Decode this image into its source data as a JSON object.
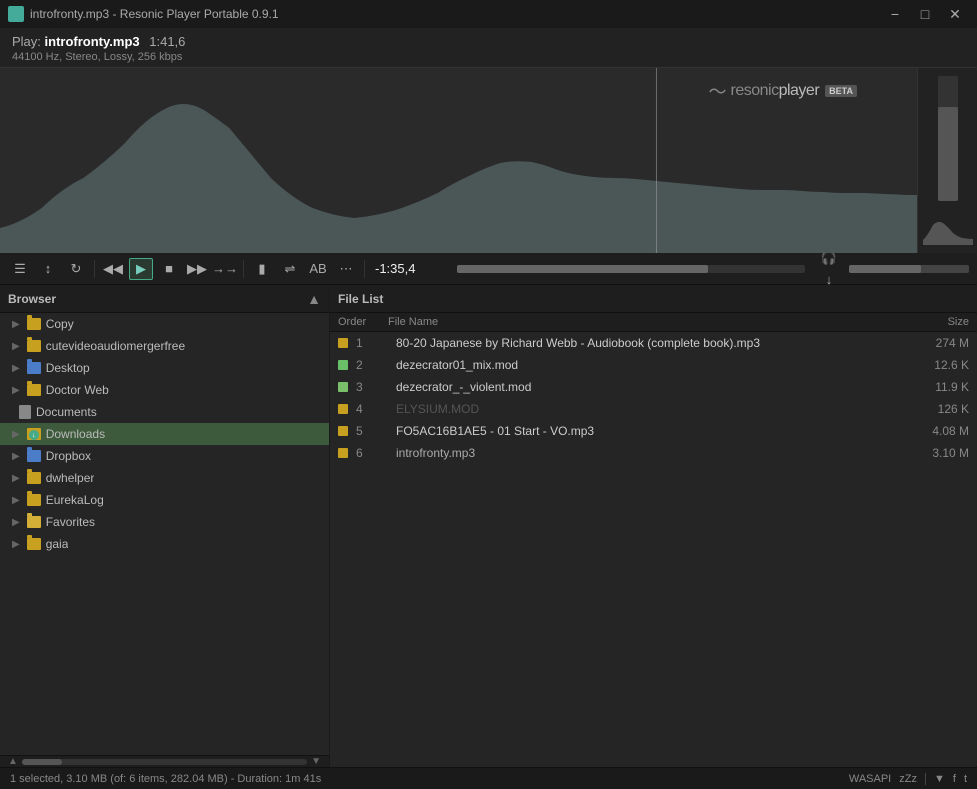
{
  "titleBar": {
    "title": "introfronty.mp3 - Resonic Player Portable 0.9.1"
  },
  "header": {
    "play_label": "Play:",
    "filename": "introfronty.mp3",
    "duration": "1:41,6",
    "audio_info": "44100 Hz, Stereo, Lossy, 256 kbps"
  },
  "logo": {
    "text": "resonic",
    "text_bold": "player",
    "beta": "BETA"
  },
  "transport": {
    "time_current": "-1:35,4",
    "buttons": [
      "menu",
      "shuffle",
      "loop",
      "prev",
      "play",
      "stop",
      "next",
      "forward",
      "mute",
      "repeat",
      "ab",
      "more"
    ]
  },
  "browser": {
    "title": "Browser",
    "items": [
      {
        "label": "Copy",
        "type": "folder",
        "color": "yellow",
        "indent": 1
      },
      {
        "label": "cutevideoaudiomergerfree",
        "type": "folder",
        "color": "yellow",
        "indent": 1
      },
      {
        "label": "Desktop",
        "type": "folder",
        "color": "blue",
        "indent": 1
      },
      {
        "label": "Doctor Web",
        "type": "folder",
        "color": "yellow",
        "indent": 1
      },
      {
        "label": "Documents",
        "type": "file",
        "color": "gray",
        "indent": 1
      },
      {
        "label": "Downloads",
        "type": "folder",
        "color": "yellow",
        "indent": 1,
        "selected": true
      },
      {
        "label": "Dropbox",
        "type": "folder",
        "color": "blue",
        "indent": 1
      },
      {
        "label": "dwhelper",
        "type": "folder",
        "color": "yellow",
        "indent": 1
      },
      {
        "label": "EurekaLog",
        "type": "folder",
        "color": "yellow",
        "indent": 1
      },
      {
        "label": "Favorites",
        "type": "folder",
        "color": "star",
        "indent": 1
      },
      {
        "label": "gaia",
        "type": "folder",
        "color": "yellow",
        "indent": 1
      }
    ]
  },
  "fileList": {
    "title": "File List",
    "columns": {
      "order": "Order",
      "filename": "File Name",
      "size": "Size"
    },
    "files": [
      {
        "order": "1",
        "name": "80-20 Japanese by Richard Webb - Audiobook (complete book).mp3",
        "size": "274 M",
        "color": "#c8a020",
        "playing": false,
        "disabled": false
      },
      {
        "order": "2",
        "name": "dezecrator01_mix.mod",
        "size": "12.6 K",
        "color": "#6abf69",
        "playing": false,
        "disabled": false
      },
      {
        "order": "3",
        "name": "dezecrator_-_violent.mod",
        "size": "11.9 K",
        "color": "#7abf6a",
        "playing": false,
        "disabled": false
      },
      {
        "order": "4",
        "name": "ELYSIUM.MOD",
        "size": "126 K",
        "color": "#c8a020",
        "playing": false,
        "disabled": true
      },
      {
        "order": "5",
        "name": "FO5AC16B1AE5 - 01 Start - VO.mp3",
        "size": "4.08 M",
        "color": "#c8a020",
        "playing": false,
        "disabled": false
      },
      {
        "order": "6",
        "name": "introfronty.mp3",
        "size": "3.10 M",
        "color": "#c8a020",
        "playing": true,
        "disabled": false
      }
    ]
  },
  "statusBar": {
    "text": "1 selected, 3.10 MB (of: 6 items, 282.04 MB) - Duration: 1m 41s",
    "wasapi": "WASAPI",
    "zzz": "zZz"
  }
}
